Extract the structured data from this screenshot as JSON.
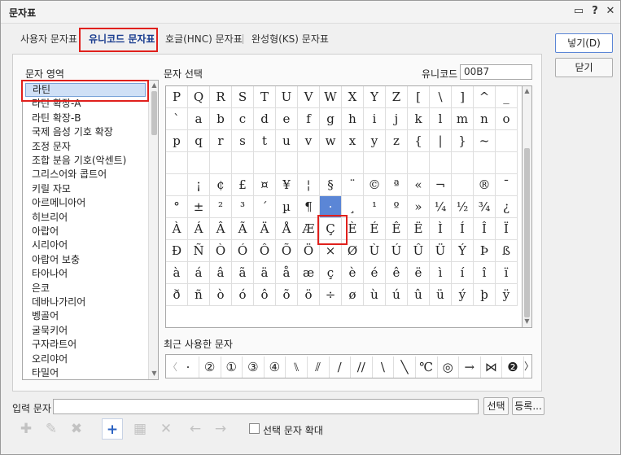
{
  "window": {
    "title": "문자표"
  },
  "title_icons": [
    {
      "name": "chat-icon",
      "glyph": "▭"
    },
    {
      "name": "help-icon",
      "glyph": "?"
    },
    {
      "name": "close-icon",
      "glyph": "✕"
    }
  ],
  "tabs": [
    {
      "label": "사용자 문자표",
      "active": false
    },
    {
      "label": "유니코드 문자표",
      "active": true
    },
    {
      "label": "호글(HNC) 문자표",
      "active": false
    },
    {
      "label": "완성형(KS) 문자표",
      "active": false
    }
  ],
  "area": {
    "label": "문자 영역",
    "items": [
      "라틴",
      "라틴 확장-A",
      "라틴 확장-B",
      "국제 음성 기호 확장",
      "조정 문자",
      "조합 분음 기호(악센트)",
      "그리스어와 콥트어",
      "키릴 자모",
      "아르메니아어",
      "히브리어",
      "아랍어",
      "시리아어",
      "아랍어 보충",
      "타아나어",
      "은코",
      "데바나가리어",
      "벵골어",
      "굴묵키어",
      "구자라트어",
      "오리야어",
      "타밀어"
    ],
    "selected_index": 0
  },
  "charsel": {
    "label": "문자 선택",
    "unicode_label": "유니코드",
    "unicode_value": "00B7"
  },
  "grid": {
    "rows": [
      [
        "P",
        "Q",
        "R",
        "S",
        "T",
        "U",
        "V",
        "W",
        "X",
        "Y",
        "Z",
        "[",
        "\\",
        "]",
        "^",
        "_"
      ],
      [
        "`",
        "a",
        "b",
        "c",
        "d",
        "e",
        "f",
        "g",
        "h",
        "i",
        "j",
        "k",
        "l",
        "m",
        "n",
        "o"
      ],
      [
        "p",
        "q",
        "r",
        "s",
        "t",
        "u",
        "v",
        "w",
        "x",
        "y",
        "z",
        "{",
        "|",
        "}",
        "~",
        ""
      ],
      [
        "",
        "",
        "",
        "",
        "",
        "",
        "",
        "",
        "",
        "",
        "",
        "",
        "",
        "",
        "",
        ""
      ],
      [
        "",
        "¡",
        "¢",
        "£",
        "¤",
        "¥",
        "¦",
        "§",
        "¨",
        "©",
        "ª",
        "«",
        "¬",
        "",
        "®",
        "¯"
      ],
      [
        "°",
        "±",
        "²",
        "³",
        "´",
        "µ",
        "¶",
        "·",
        "¸",
        "¹",
        "º",
        "»",
        "¼",
        "½",
        "¾",
        "¿"
      ],
      [
        "À",
        "Á",
        "Â",
        "Ã",
        "Ä",
        "Å",
        "Æ",
        "Ç",
        "È",
        "É",
        "Ê",
        "Ë",
        "Ì",
        "Í",
        "Î",
        "Ï"
      ],
      [
        "Ð",
        "Ñ",
        "Ò",
        "Ó",
        "Ô",
        "Õ",
        "Ö",
        "×",
        "Ø",
        "Ù",
        "Ú",
        "Û",
        "Ü",
        "Ý",
        "Þ",
        "ß"
      ],
      [
        "à",
        "á",
        "â",
        "ã",
        "ä",
        "å",
        "æ",
        "ç",
        "è",
        "é",
        "ê",
        "ë",
        "ì",
        "í",
        "î",
        "ï"
      ],
      [
        "ð",
        "ñ",
        "ò",
        "ó",
        "ô",
        "õ",
        "ö",
        "÷",
        "ø",
        "ù",
        "ú",
        "û",
        "ü",
        "ý",
        "þ",
        "ÿ"
      ]
    ],
    "selected_char": "·"
  },
  "recent": {
    "label": "최근 사용한 문자",
    "chars": [
      "·",
      "②",
      "①",
      "③",
      "④",
      "⑊",
      "⫽",
      "/",
      "//",
      "\\",
      "╲",
      "℃",
      "◎",
      "→",
      "⋈",
      "❷"
    ]
  },
  "input": {
    "label": "입력 문자",
    "value": "",
    "select_btn": "선택",
    "register_btn": "등록..."
  },
  "toolbar": [
    {
      "name": "add-user-char-icon",
      "glyph": "✚",
      "enabled": false
    },
    {
      "name": "edit-char-icon",
      "glyph": "✎",
      "enabled": false
    },
    {
      "name": "delete-char-icon",
      "glyph": "✖",
      "enabled": false
    },
    {
      "name": "add-icon",
      "glyph": "+",
      "enabled": true
    },
    {
      "name": "insert-row-icon",
      "glyph": "▦",
      "enabled": false
    },
    {
      "name": "remove-icon",
      "glyph": "✕",
      "enabled": false
    },
    {
      "name": "arrow-left-icon",
      "glyph": "←",
      "enabled": false
    },
    {
      "name": "arrow-right-icon",
      "glyph": "→",
      "enabled": false
    }
  ],
  "enlarge": {
    "label": "선택 문자 확대",
    "checked": false
  },
  "buttons": {
    "insert": "넣기(D)",
    "close": "닫기"
  }
}
